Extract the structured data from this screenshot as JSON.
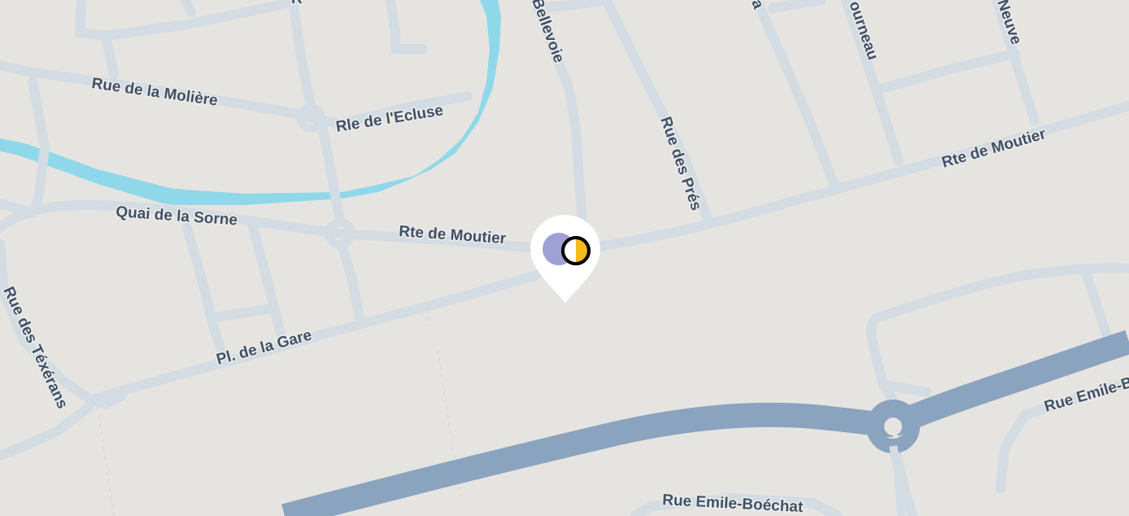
{
  "map": {
    "streets": {
      "rue_de_la_moliere": "Rue de la Molière",
      "rle_de_lecluse": "Rle de l'Ecluse",
      "quai_de_la_sorne": "Quai de la Sorne",
      "rte_de_moutier_west": "Rte de Moutier",
      "rte_de_moutier_east": "Rte de Moutier",
      "pl_de_la_gare": "Pl. de la Gare",
      "rue_des_texerans": "Rue des Téxérans",
      "bellevoie": "Bellevoie",
      "rue_des_pres": "Rue des Prés",
      "fourneau": "ourneau",
      "neuve": "Neuve",
      "rue_emile_boechat_south": "Rue Emile-Boéchat",
      "rue_emile_boechat_east": "Rue Emile-B",
      "top_fragment_a": "R",
      "top_fragment_b": "a"
    },
    "marker": {
      "left_circle_color": "#9ea1d4",
      "right_circle_color": "#f6b91a"
    },
    "colors": {
      "background": "#e6e4e0",
      "minor_road": "#d3dbe3",
      "major_road": "#8aa3bf",
      "river": "#8fd8ea",
      "label": "#3f5068"
    }
  }
}
